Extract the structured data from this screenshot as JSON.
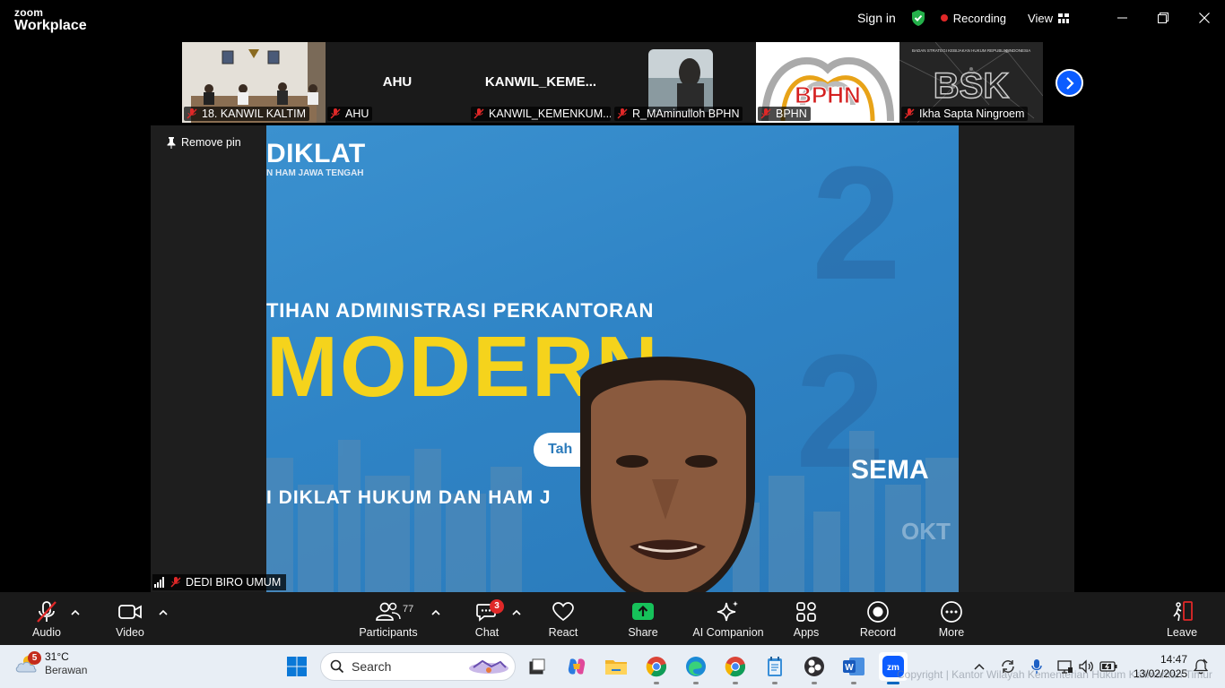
{
  "app": {
    "logo_top": "zoom",
    "logo_bottom": "Workplace"
  },
  "titlebar": {
    "sign_in": "Sign in",
    "recording": "Recording",
    "view": "View"
  },
  "thumbnails": [
    {
      "name": "18. KANWIL KALTIM",
      "type": "video"
    },
    {
      "name": "AHU",
      "center": "AHU",
      "type": "name"
    },
    {
      "name": "KANWIL_KEMENKUM...",
      "center": "KANWIL_KEME...",
      "type": "name"
    },
    {
      "name": "R_MAminulloh BPHN",
      "type": "video"
    },
    {
      "name": "BPHN",
      "type": "logo",
      "logo_text": "BPHN"
    },
    {
      "name": "Ikha Sapta Ningroem",
      "type": "logo",
      "logo_text": "BSK",
      "logo_sub": "BADAN STRATEGI KEBIJAKAN HUKUM REPUBLIK INDONESIA"
    }
  ],
  "main": {
    "remove_pin": "Remove pin",
    "speaker_name": "DEDI BIRO UMUM",
    "slide": {
      "diklat": "DIKLAT",
      "sub": "N HAM JAWA TENGAH",
      "pelatihan": "TIHAN ADMINISTRASI PERKANTORAN",
      "modern": "MODERN",
      "tahun": "Tah",
      "diklat_hukum": "I DIKLAT HUKUM DAN HAM J",
      "semarang": "SEMA",
      "okt": "OKT"
    }
  },
  "toolbar": {
    "audio": "Audio",
    "video": "Video",
    "participants": "Participants",
    "participants_count": "77",
    "chat": "Chat",
    "chat_badge": "3",
    "react": "React",
    "share": "Share",
    "ai_companion": "AI Companion",
    "apps": "Apps",
    "record": "Record",
    "more": "More",
    "leave": "Leave"
  },
  "taskbar": {
    "weather_temp": "31°C",
    "weather_desc": "Berawan",
    "weather_badge": "5",
    "search_placeholder": "Search",
    "time": "14:47",
    "date": "13/02/2025",
    "watermark": "Copyright | Kantor Wilayah Kementerian Hukum Kalimantan Timur"
  },
  "colors": {
    "accent": "#0b5cff",
    "recording": "#e02828",
    "share": "#16c15a",
    "modern_yellow": "#f5d31c"
  }
}
